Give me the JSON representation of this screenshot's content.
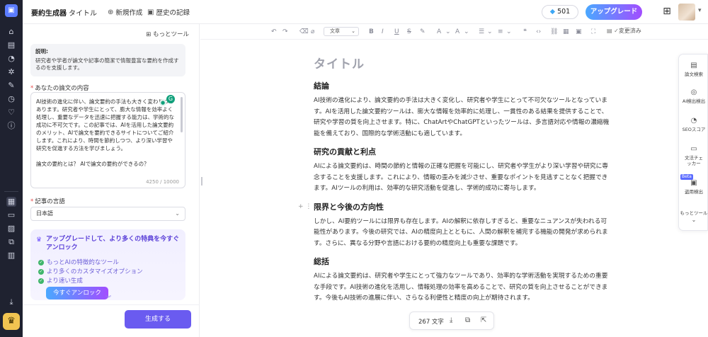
{
  "header": {
    "app_title": "要約生成器",
    "tab": "タイトル",
    "new_label": "新規作成",
    "history_label": "歴史の記録",
    "credits": "501",
    "upgrade_label": "アップグレード"
  },
  "panel": {
    "more_tools": "もっとツール",
    "description_title": "説明:",
    "description_text": "研究者や学者が論文や記事の簡潔で情報豊富な要約を作成するのを支援します。",
    "essay_label": "あなたの論文の内容",
    "essay_text": "AI技術の進化に伴い、論文要約の手法も大きく変わりつつあります。研究者や学生にとって、膨大な情報を効率よく処理し、重要なデータを迅速に把握する能力は、学術的な成功に不可欠です。この記事では、AIを活用した論文要約のメリット、AIで論文を要約できるサイトについてご紹介します。これにより、時間を節約しつつ、より深い学習や研究を促進する方法を学びましょう。\n\n論文の要約とは？ AIで論文の要約ができるの？\n\n論文の要約とは？",
    "essay_count": "4250 / 10000",
    "language_label": "記事の言語",
    "language_value": "日本語",
    "promo_title": "アップグレードして、より多くの特典を今すぐアンロック",
    "promo_items": [
      "もっとAIの特徴的なツール",
      "より多くのカスタマイズオプション",
      "より速い生成"
    ],
    "unlock_label": "今すぐアンロック",
    "generate_label": "生成する"
  },
  "toolbar": {
    "style_select": "文章",
    "saved_label": "変更済み"
  },
  "document": {
    "title": "タイトル",
    "sections": [
      {
        "heading": "結論",
        "text": "AI技術の進化により、論文要約の手法は大きく変化し、研究者や学生にとって不可欠なツールとなっています。AIを活用した論文要約ツールは、膨大な情報を効率的に処理し、一貫性のある結果を提供することで、研究や学習の質を向上させます。特に、ChatArtやChatGPTといったツールは、多言語対応や情報の濃縮機能を備えており、国際的な学術活動にも適しています。"
      },
      {
        "heading": "研究の貢献と利点",
        "text": "AIによる論文要約は、時間の節約と情報の正確な把握を可能にし、研究者や学生がより深い学習や研究に専念することを支援します。これにより、情報の歪みを減少させ、重要なポイントを見逃すことなく把握できます。AIツールの利用は、効率的な研究活動を促進し、学術的成功に寄与します。"
      },
      {
        "heading": "限界と今後の方向性",
        "text": "しかし、AI要約ツールには限界も存在します。AIの解釈に依存しすぎると、重要なニュアンスが失われる可能性があります。今後の研究では、AIの精度向上とともに、人間の解釈を補完する機能の開発が求められます。さらに、異なる分野や言語における要約の精度向上も重要な課題です。"
      },
      {
        "heading": "総括",
        "text": "AIによる論文要約は、研究者や学生にとって強力なツールであり、効率的な学術活動を実現するための重要な手段です。AI技術の進化を活用し、情報処理の効率を高めることで、研究の質を向上させることができます。今後もAI技術の進展に伴い、さらなる利便性と精度の向上が期待されます。"
      }
    ]
  },
  "word_count": "267 文字",
  "right_tools": {
    "items": [
      "論文検索",
      "AI検出検出",
      "SEOスコア",
      "文法チェッカー",
      "盗用検出",
      "もっとツール"
    ],
    "beta": "Beta"
  }
}
